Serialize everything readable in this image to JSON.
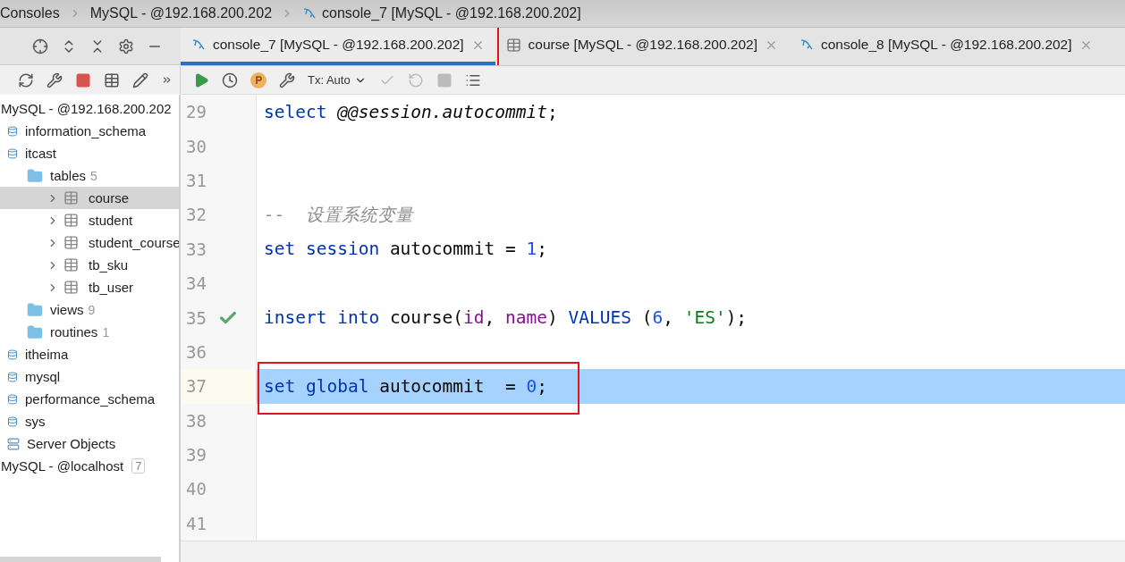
{
  "breadcrumb": [
    "Consoles",
    "MySQL - @192.168.200.202",
    "console_7 [MySQL - @192.168.200.202]"
  ],
  "tabs": [
    {
      "label": "console_7 [MySQL - @192.168.200.202]",
      "kind": "console",
      "selected": true,
      "boxed": true
    },
    {
      "label": "course [MySQL - @192.168.200.202]",
      "kind": "table",
      "selected": false,
      "boxed": false
    },
    {
      "label": "console_8 [MySQL - @192.168.200.202]",
      "kind": "console",
      "selected": false,
      "boxed": false
    }
  ],
  "editor_toolbar": {
    "tx_mode": "Tx: Auto"
  },
  "tree": [
    {
      "label": "MySQL - @192.168.200.202",
      "kind": "connection",
      "selected": false,
      "children": [
        {
          "label": "information_schema",
          "kind": "schema",
          "selected": false
        },
        {
          "label": "itcast",
          "kind": "schema",
          "selected": false,
          "children": [
            {
              "label": "tables",
              "kind": "folder",
              "count": "5",
              "selected": false,
              "children": [
                {
                  "label": "course",
                  "kind": "table",
                  "selected": true
                },
                {
                  "label": "student",
                  "kind": "table",
                  "selected": false
                },
                {
                  "label": "student_course",
                  "kind": "table",
                  "selected": false
                },
                {
                  "label": "tb_sku",
                  "kind": "table",
                  "selected": false
                },
                {
                  "label": "tb_user",
                  "kind": "table",
                  "selected": false
                }
              ]
            },
            {
              "label": "views",
              "kind": "folder",
              "count": "9",
              "selected": false
            },
            {
              "label": "routines",
              "kind": "folder",
              "count": "1",
              "selected": false
            }
          ]
        },
        {
          "label": "itheima",
          "kind": "schema",
          "selected": false
        },
        {
          "label": "mysql",
          "kind": "schema",
          "selected": false
        },
        {
          "label": "performance_schema",
          "kind": "schema",
          "selected": false
        },
        {
          "label": "sys",
          "kind": "schema",
          "selected": false
        },
        {
          "label": "Server Objects",
          "kind": "group",
          "selected": false
        }
      ]
    },
    {
      "label": "MySQL - @localhost",
      "kind": "connection",
      "badge": "7",
      "selected": false
    }
  ],
  "lines": [
    {
      "number": "29",
      "tokens": [
        {
          "text": "select ",
          "kind": "keyword"
        },
        {
          "text": "@@session.autocommit",
          "kind": "variable"
        },
        {
          "text": ";",
          "kind": "plain"
        }
      ]
    },
    {
      "number": "30"
    },
    {
      "number": "31"
    },
    {
      "number": "32",
      "tokens": [
        {
          "text": "--  设置系统变量",
          "kind": "comment"
        }
      ]
    },
    {
      "number": "33",
      "tokens": [
        {
          "text": "set session",
          "kind": "keyword"
        },
        {
          "text": " autocommit = ",
          "kind": "plain"
        },
        {
          "text": "1",
          "kind": "number"
        },
        {
          "text": ";",
          "kind": "plain"
        }
      ]
    },
    {
      "number": "34"
    },
    {
      "number": "35",
      "executed": true,
      "tokens": [
        {
          "text": "insert into",
          "kind": "keyword"
        },
        {
          "text": " course(",
          "kind": "plain"
        },
        {
          "text": "id",
          "kind": "column"
        },
        {
          "text": ", ",
          "kind": "plain"
        },
        {
          "text": "name",
          "kind": "column"
        },
        {
          "text": ") ",
          "kind": "plain"
        },
        {
          "text": "VALUES",
          "kind": "keyword"
        },
        {
          "text": " (",
          "kind": "plain"
        },
        {
          "text": "6",
          "kind": "number"
        },
        {
          "text": ", ",
          "kind": "plain"
        },
        {
          "text": "'ES'",
          "kind": "string"
        },
        {
          "text": ");",
          "kind": "plain"
        }
      ]
    },
    {
      "number": "36"
    },
    {
      "number": "37",
      "selected": true,
      "boxed": true,
      "tokens": [
        {
          "text": "set global",
          "kind": "keyword"
        },
        {
          "text": " autocommit  = ",
          "kind": "plain"
        },
        {
          "text": "0",
          "kind": "number"
        },
        {
          "text": ";",
          "kind": "plain"
        }
      ]
    },
    {
      "number": "38"
    },
    {
      "number": "39"
    },
    {
      "number": "40"
    },
    {
      "number": "41"
    }
  ]
}
